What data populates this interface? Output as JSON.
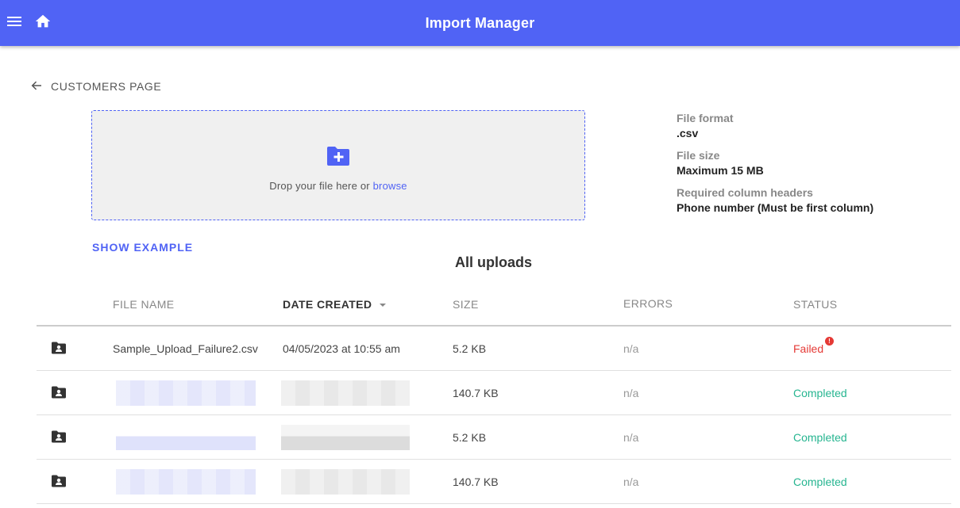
{
  "appbar": {
    "title": "Import Manager",
    "menu_icon": "menu-icon",
    "home_icon": "home-icon",
    "color": "#5063f5"
  },
  "back_link": {
    "label": "CUSTOMERS PAGE",
    "icon": "arrow-left-icon"
  },
  "dropzone": {
    "icon": "folder-plus-icon",
    "text": "Drop your file here or",
    "browse_label": "browse"
  },
  "show_example_label": "SHOW EXAMPLE",
  "info": {
    "file_format_label": "File format",
    "file_format_value": ".csv",
    "file_size_label": "File size",
    "file_size_value": "Maximum 15 MB",
    "headers_label": "Required column headers",
    "headers_value": "Phone number (Must be first column)"
  },
  "uploads": {
    "title": "All uploads",
    "columns": {
      "file_name": "FILE NAME",
      "date_created": "DATE CREATED",
      "size": "SIZE",
      "errors": "ERRORS",
      "status": "STATUS"
    },
    "rows": [
      {
        "file_name": "Sample_Upload_Failure2.csv",
        "date_created": "04/05/2023 at 10:55 am",
        "size": "5.2 KB",
        "errors": "n/a",
        "status": "Failed"
      },
      {
        "file_name": "",
        "date_created": "",
        "size": "140.7 KB",
        "errors": "n/a",
        "status": "Completed"
      },
      {
        "file_name": "",
        "date_created": "",
        "size": "5.2 KB",
        "errors": "n/a",
        "status": "Completed"
      },
      {
        "file_name": "",
        "date_created": "",
        "size": "140.7 KB",
        "errors": "n/a",
        "status": "Completed"
      }
    ]
  },
  "colors": {
    "accent": "#5063f5",
    "failed": "#e53935",
    "completed": "#26b590"
  }
}
